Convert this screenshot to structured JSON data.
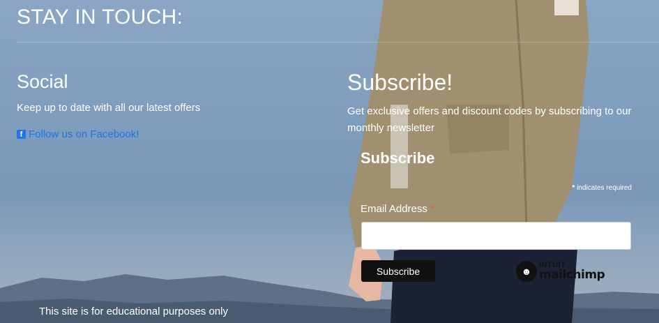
{
  "header": {
    "title": "STAY IN TOUCH:"
  },
  "social": {
    "title": "Social",
    "text": "Keep up to date with all our latest offers",
    "facebook_link": "Follow us on Facebook!",
    "facebook_icon": "facebook-icon",
    "link_color": "#1f76e6"
  },
  "subscribe": {
    "title": "Subscribe!",
    "text": "Get exclusive offers and discount codes by subscribing to our monthly newsletter",
    "form_title": "Subscribe",
    "required_note": "indicates required",
    "required_star": "*",
    "email_label": "Email Address",
    "email_value": "",
    "button_label": "Subscribe"
  },
  "mailchimp": {
    "intuit": "INTUIT",
    "name": "mailchimp",
    "logo_icon": "mailchimp-logo-icon"
  },
  "footer": {
    "note": "This site is for educational purposes only"
  }
}
